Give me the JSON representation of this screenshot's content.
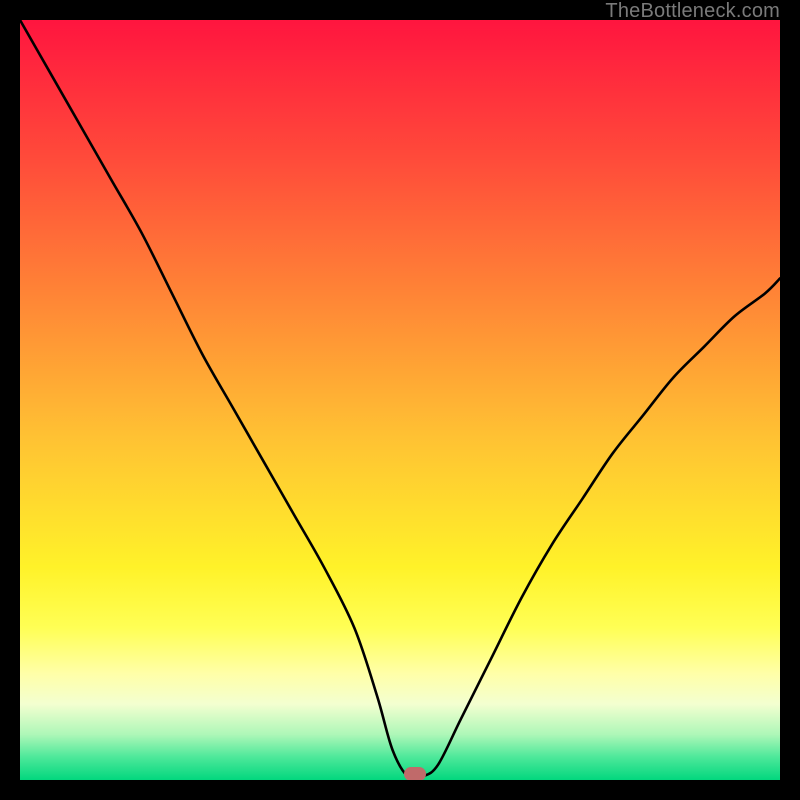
{
  "watermark": "TheBottleneck.com",
  "chart_data": {
    "type": "line",
    "title": "",
    "xlabel": "",
    "ylabel": "",
    "xlim": [
      0,
      100
    ],
    "ylim": [
      0,
      100
    ],
    "x": [
      0,
      4,
      8,
      12,
      16,
      20,
      24,
      28,
      32,
      36,
      40,
      44,
      47,
      49,
      51,
      53,
      55,
      58,
      62,
      66,
      70,
      74,
      78,
      82,
      86,
      90,
      94,
      98,
      100
    ],
    "values": [
      100,
      93,
      86,
      79,
      72,
      64,
      56,
      49,
      42,
      35,
      28,
      20,
      11,
      4,
      0.5,
      0.5,
      2,
      8,
      16,
      24,
      31,
      37,
      43,
      48,
      53,
      57,
      61,
      64,
      66
    ],
    "marker": {
      "x": 52,
      "y": 0.8,
      "color": "#c06a6a"
    },
    "gradient_stops": [
      {
        "offset": 0.0,
        "color": "#ff153f"
      },
      {
        "offset": 0.18,
        "color": "#ff4a3a"
      },
      {
        "offset": 0.36,
        "color": "#ff8436"
      },
      {
        "offset": 0.55,
        "color": "#ffc233"
      },
      {
        "offset": 0.72,
        "color": "#fff229"
      },
      {
        "offset": 0.8,
        "color": "#ffff55"
      },
      {
        "offset": 0.86,
        "color": "#ffffa8"
      },
      {
        "offset": 0.9,
        "color": "#f3ffd0"
      },
      {
        "offset": 0.94,
        "color": "#aef7b8"
      },
      {
        "offset": 0.97,
        "color": "#4de89a"
      },
      {
        "offset": 1.0,
        "color": "#02d77e"
      }
    ]
  }
}
